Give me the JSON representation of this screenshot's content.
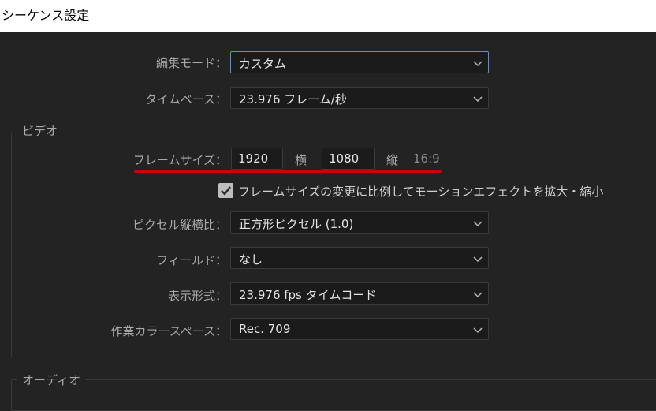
{
  "window": {
    "title": "シーケンス設定"
  },
  "general": {
    "edit_mode_label": "編集モード：",
    "edit_mode_value": "カスタム",
    "timebase_label": "タイムベース：",
    "timebase_value": "23.976  フレーム/秒"
  },
  "video": {
    "section_title": "ビデオ",
    "frame_size_label": "フレームサイズ：",
    "width_value": "1920",
    "width_unit": "横",
    "height_value": "1080",
    "height_unit": "縦",
    "aspect_ratio": "16:9",
    "scale_checkbox_label": "フレームサイズの変更に比例してモーションエフェクトを拡大・縮小",
    "scale_checkbox_checked": true,
    "pixel_aspect_label": "ピクセル縦横比：",
    "pixel_aspect_value": "正方形ピクセル (1.0)",
    "fields_label": "フィールド：",
    "fields_value": "なし",
    "display_format_label": "表示形式：",
    "display_format_value": "23.976  fps タイムコード",
    "color_space_label": "作業カラースペース：",
    "color_space_value": "Rec. 709"
  },
  "audio": {
    "section_title": "オーディオ"
  },
  "colors": {
    "focus_border": "#5d8fd1",
    "annotation_underline": "#d10000",
    "background": "#232323"
  }
}
